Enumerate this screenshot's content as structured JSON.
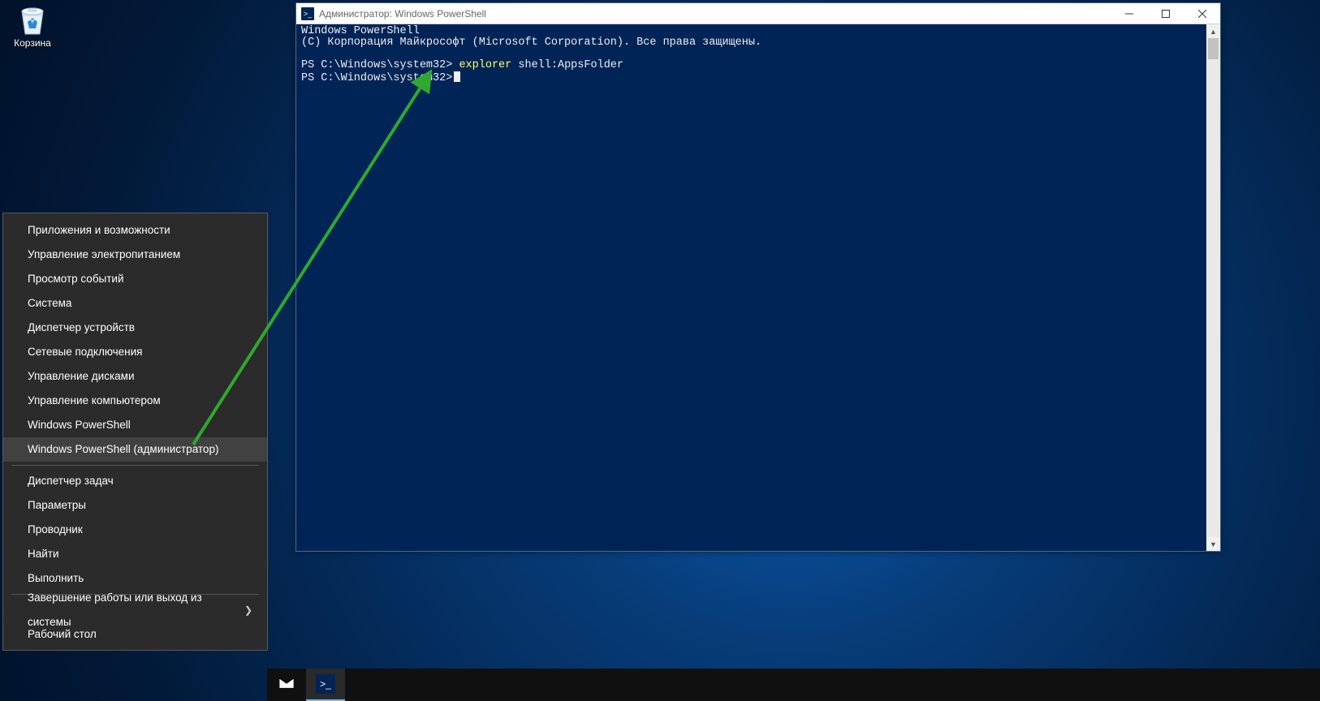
{
  "desktop": {
    "recycle_bin_label": "Корзина"
  },
  "winx_menu": {
    "items": [
      {
        "label": "Приложения и возможности",
        "highlighted": false
      },
      {
        "label": "Управление электропитанием",
        "highlighted": false
      },
      {
        "label": "Просмотр событий",
        "highlighted": false
      },
      {
        "label": "Система",
        "highlighted": false
      },
      {
        "label": "Диспетчер устройств",
        "highlighted": false
      },
      {
        "label": "Сетевые подключения",
        "highlighted": false
      },
      {
        "label": "Управление дисками",
        "highlighted": false
      },
      {
        "label": "Управление компьютером",
        "highlighted": false
      },
      {
        "label": "Windows PowerShell",
        "highlighted": false
      },
      {
        "label": "Windows PowerShell (администратор)",
        "highlighted": true
      }
    ],
    "items2": [
      {
        "label": "Диспетчер задач"
      },
      {
        "label": "Параметры"
      },
      {
        "label": "Проводник"
      },
      {
        "label": "Найти"
      },
      {
        "label": "Выполнить"
      }
    ],
    "items3": [
      {
        "label": "Завершение работы или выход из системы",
        "has_submenu": true
      },
      {
        "label": "Рабочий стол",
        "has_submenu": false
      }
    ]
  },
  "powershell": {
    "title": "Администратор: Windows PowerShell",
    "line1": "Windows PowerShell",
    "line2": "(C) Корпорация Майкрософт (Microsoft Corporation). Все права защищены.",
    "prompt1_prefix": "PS C:\\Windows\\system32>",
    "prompt1_cmd": "explorer",
    "prompt1_arg": "shell:AppsFolder",
    "prompt2_prefix": "PS C:\\Windows\\system32>"
  },
  "taskbar": {
    "items": [
      {
        "name": "mail",
        "active": false
      },
      {
        "name": "powershell",
        "active": true
      }
    ]
  },
  "colors": {
    "ps_bg": "#012456",
    "ps_cmd_yellow": "#ffff66",
    "arrow": "#2fa82f"
  }
}
